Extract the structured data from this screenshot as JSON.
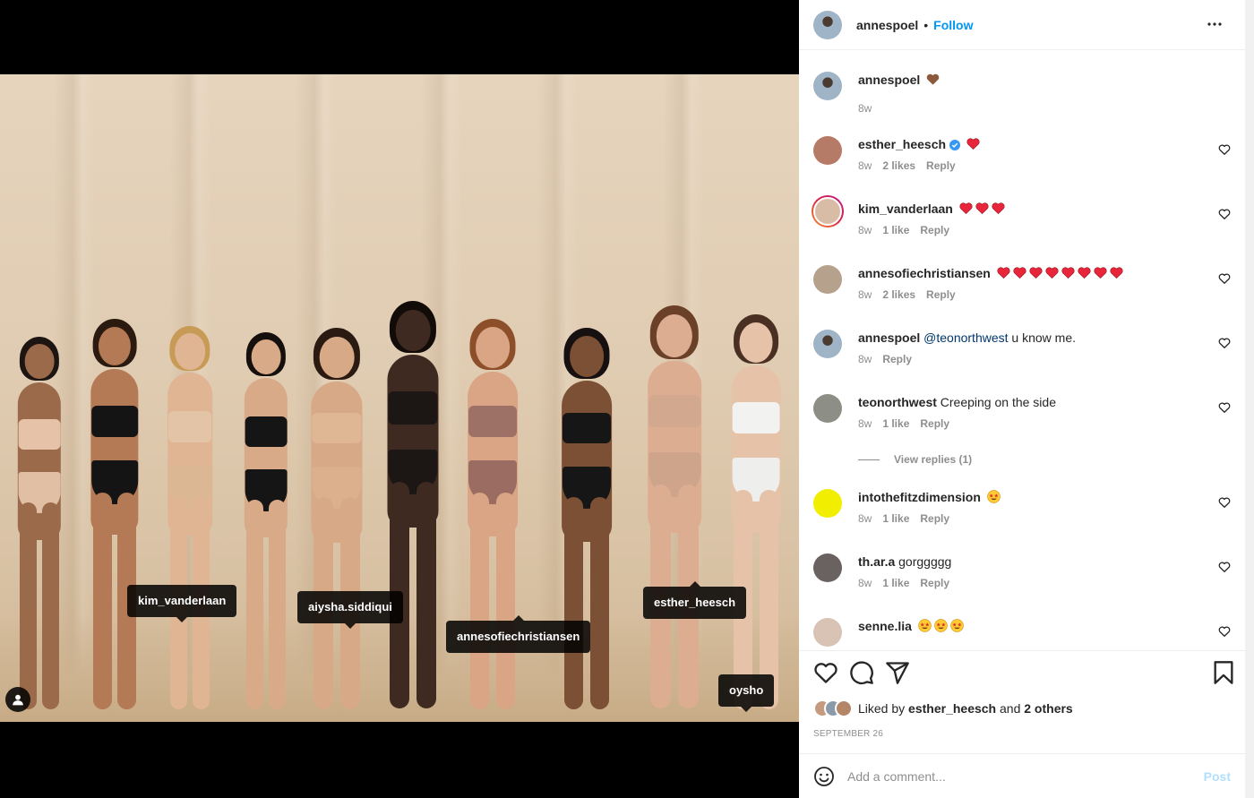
{
  "colors": {
    "accent": "#0095f6",
    "text": "#262626",
    "muted": "#8e8e8e",
    "heart": "#ed4956",
    "verified": "#3897f0"
  },
  "media": {
    "tags": [
      {
        "label": "kim_vanderlaan"
      },
      {
        "label": "aiysha.siddiqui"
      },
      {
        "label": "annesofiechristiansen"
      },
      {
        "label": "esther_heesch"
      },
      {
        "label": "oysho"
      }
    ],
    "user_tags_icon": "user-icon"
  },
  "header": {
    "username": "annespoel",
    "separator": "•",
    "follow_label": "Follow",
    "more_icon": "more-horizontal-icon"
  },
  "caption": {
    "username": "annespoel",
    "emoji": "brown-heart",
    "time": "8w"
  },
  "comments": [
    {
      "username": "esther_heesch",
      "verified": true,
      "text": "",
      "emoji_count": 1,
      "emoji": "red-heart",
      "time": "8w",
      "likes": "2 likes",
      "reply": "Reply"
    },
    {
      "username": "kim_vanderlaan",
      "text": "",
      "emoji_count": 3,
      "emoji": "red-heart",
      "time": "8w",
      "likes": "1 like",
      "reply": "Reply"
    },
    {
      "username": "annesofiechristiansen",
      "text": "",
      "emoji_count": 8,
      "emoji": "red-heart",
      "time": "8w",
      "likes": "2 likes",
      "reply": "Reply"
    },
    {
      "username": "annespoel",
      "mention": "@teonorthwest",
      "text": " u know me.",
      "time": "8w",
      "likes": "",
      "reply": "Reply"
    },
    {
      "username": "teonorthwest",
      "text": "Creeping on the side",
      "time": "8w",
      "likes": "1 like",
      "reply": "Reply",
      "view_replies": "View replies (1)"
    },
    {
      "username": "intothefitzdimension",
      "text": "",
      "emoji_count": 1,
      "emoji": "star-struck",
      "time": "8w",
      "likes": "1 like",
      "reply": "Reply"
    },
    {
      "username": "th.ar.a",
      "text": "gorggggg",
      "time": "8w",
      "likes": "1 like",
      "reply": "Reply"
    },
    {
      "username": "senne.lia",
      "text": "",
      "emoji_count": 3,
      "emoji": "star-struck"
    }
  ],
  "actions": {
    "like_icon": "heart-icon",
    "comment_icon": "comment-icon",
    "share_icon": "share-icon",
    "save_icon": "bookmark-icon"
  },
  "likes": {
    "prefix": "Liked by",
    "user": "esther_heesch",
    "middle": "and",
    "others": "2 others"
  },
  "date": "SEPTEMBER 26",
  "add_comment": {
    "placeholder": "Add a comment...",
    "post_label": "Post",
    "emoji_icon": "smiley-icon"
  }
}
